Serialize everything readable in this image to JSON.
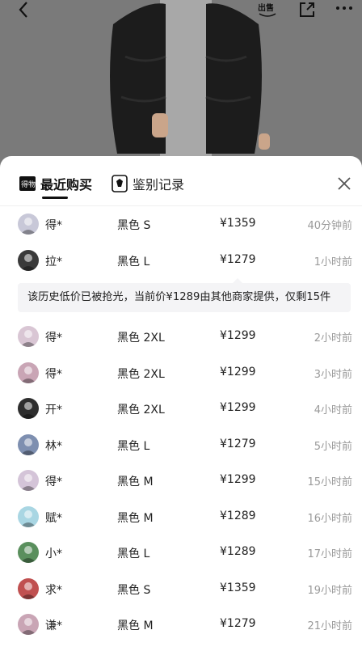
{
  "colors": {
    "accent": "#111111",
    "muted": "#9a9a9a",
    "notice_bg": "#f4f4f6"
  },
  "topbar": {
    "back_icon": "chevron-left-icon",
    "sell_label": "出售",
    "share_icon": "share-icon",
    "more_icon": "more-dots-icon"
  },
  "tabs": [
    {
      "label": "最近购买",
      "icon": "receipt-icon",
      "active": true
    },
    {
      "label": "鉴别记录",
      "icon": "authenticate-badge-icon",
      "active": false
    }
  ],
  "notice": "该历史低价已被抢光，当前价¥1289由其他商家提供，仅剩15件",
  "purchases": [
    {
      "user": "得*",
      "sku": "黑色 S",
      "price": "¥1359",
      "time": "40分钟前",
      "avatar": "#c8c8d8"
    },
    {
      "user": "拉*",
      "sku": "黑色 L",
      "price": "¥1279",
      "time": "1小时前",
      "avatar": "#3a3a3a"
    },
    {
      "user": "得*",
      "sku": "黑色 2XL",
      "price": "¥1299",
      "time": "2小时前",
      "avatar": "#d9c6d4"
    },
    {
      "user": "得*",
      "sku": "黑色 2XL",
      "price": "¥1299",
      "time": "3小时前",
      "avatar": "#c9a5b5"
    },
    {
      "user": "开*",
      "sku": "黑色 2XL",
      "price": "¥1299",
      "time": "4小时前",
      "avatar": "#2e2e2e"
    },
    {
      "user": "林*",
      "sku": "黑色 L",
      "price": "¥1279",
      "time": "5小时前",
      "avatar": "#7e8fb0"
    },
    {
      "user": "得*",
      "sku": "黑色 M",
      "price": "¥1299",
      "time": "15小时前",
      "avatar": "#d4c4d8"
    },
    {
      "user": "赋*",
      "sku": "黑色 M",
      "price": "¥1289",
      "time": "16小时前",
      "avatar": "#a9d6e3"
    },
    {
      "user": "小*",
      "sku": "黑色 L",
      "price": "¥1289",
      "time": "17小时前",
      "avatar": "#5a8f5d"
    },
    {
      "user": "求*",
      "sku": "黑色 S",
      "price": "¥1359",
      "time": "19小时前",
      "avatar": "#c05050"
    },
    {
      "user": "谦*",
      "sku": "黑色 M",
      "price": "¥1279",
      "time": "21小时前",
      "avatar": "#c9a5b5"
    }
  ]
}
